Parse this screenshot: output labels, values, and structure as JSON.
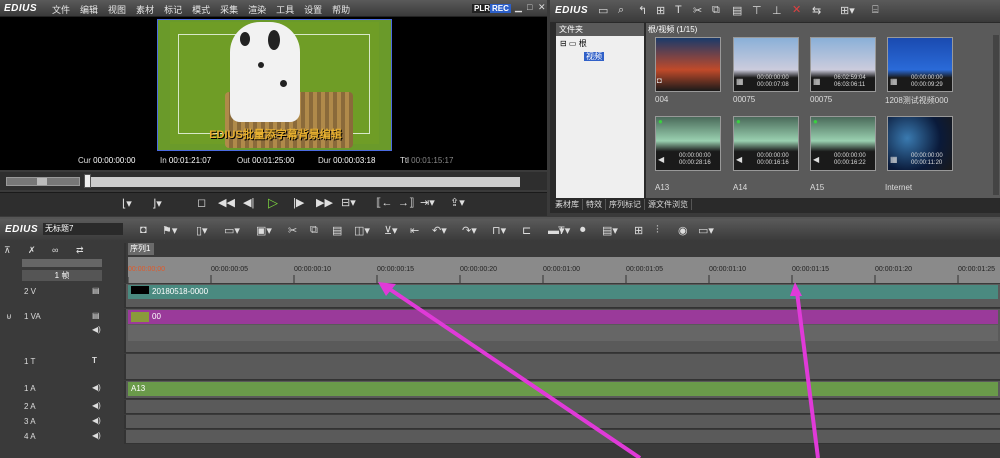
{
  "app": {
    "logo": "EDIUS",
    "plr": "PLR",
    "rec": "REC"
  },
  "menu": [
    "文件",
    "编辑",
    "视图",
    "素材",
    "标记",
    "模式",
    "采集",
    "渲染",
    "工具",
    "设置",
    "帮助"
  ],
  "preview": {
    "caption": "EDIUS批量添字幕背景编辑"
  },
  "timecodes": {
    "cur_label": "Cur",
    "cur": "00:00:00:00",
    "in_label": "In",
    "in": "00:01:21:07",
    "out_label": "Out",
    "out": "00:01:25:00",
    "dur_label": "Dur",
    "dur": "00:00:03:18",
    "ttl_label": "Ttl",
    "ttl": "00:01:15:17"
  },
  "bin": {
    "logo": "EDIUS",
    "folder_header": "文件夹",
    "root": "根",
    "video_folder": "视频",
    "path": "根/视频 (1/15)",
    "clips": [
      {
        "name": "004",
        "tc1": "",
        "tc2": ""
      },
      {
        "name": "00075",
        "tc1": "00:00:00:00",
        "tc2": "00:00:07:08"
      },
      {
        "name": "00075",
        "tc1": "06:02:59:04",
        "tc2": "06:03:06:11"
      },
      {
        "name": "1208测试视频000",
        "tc1": "00:00:00:00",
        "tc2": "00:00:09:29"
      },
      {
        "name": "A13",
        "tc1": "00:00:00:00",
        "tc2": "00:00:28:16"
      },
      {
        "name": "A14",
        "tc1": "00:00:00:00",
        "tc2": "00:00:16:16"
      },
      {
        "name": "A15",
        "tc1": "00:00:00:00",
        "tc2": "00:00:16:22"
      },
      {
        "name": "Internet",
        "tc1": "00:00:00:00",
        "tc2": "00:00:11:20"
      }
    ],
    "tabs": [
      "素材库",
      "特效",
      "序列标记",
      "源文件浏览"
    ]
  },
  "timeline": {
    "logo": "EDIUS",
    "project": "无标题7",
    "sequence_tab": "序列1",
    "zoom": "1 帧",
    "ruler": [
      "00:00:00;00",
      "00:00:00:05",
      "00:00:00:10",
      "00:00:00:15",
      "00:00:00:20",
      "00:00:01:00",
      "00:00:01:05",
      "00:00:01:10",
      "00:00:01:15",
      "00:00:01:20",
      "00:00:01:25"
    ],
    "tracks": [
      {
        "name": "2 V",
        "clip": "20180518-0000"
      },
      {
        "name": "1 VA",
        "clip": "00"
      },
      {
        "name": "1 T",
        "clip": ""
      },
      {
        "name": "1 A",
        "clip": "A13"
      },
      {
        "name": "2 A",
        "clip": ""
      },
      {
        "name": "3 A",
        "clip": ""
      },
      {
        "name": "4 A",
        "clip": ""
      }
    ]
  }
}
